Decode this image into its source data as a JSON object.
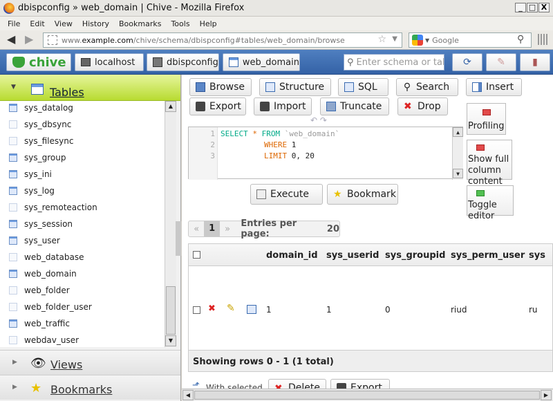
{
  "window": {
    "title": "dbispconfig » web_domain | Chive - Mozilla Firefox",
    "minimize": "_",
    "maximize": "□",
    "close": "X"
  },
  "menu": [
    "File",
    "Edit",
    "View",
    "History",
    "Bookmarks",
    "Tools",
    "Help"
  ],
  "nav": {
    "back": "◀",
    "forward": "▶",
    "url_prefix": "www.",
    "url_host": "example.com",
    "url_path": "/chive/schema/dbispconfig#tables/web_domain/browse",
    "search_placeholder": "Google"
  },
  "header": {
    "logo": "chive",
    "host": "localhost",
    "schema": "dbispconfig",
    "table": "web_domain",
    "schema_search_placeholder": "Enter schema or table"
  },
  "sidebar": {
    "tables_label": "Tables",
    "tables": [
      {
        "name": "sys_datalog",
        "on": true
      },
      {
        "name": "sys_dbsync",
        "on": false
      },
      {
        "name": "sys_filesync",
        "on": false
      },
      {
        "name": "sys_group",
        "on": true
      },
      {
        "name": "sys_ini",
        "on": true
      },
      {
        "name": "sys_log",
        "on": true
      },
      {
        "name": "sys_remoteaction",
        "on": false
      },
      {
        "name": "sys_session",
        "on": true
      },
      {
        "name": "sys_user",
        "on": true
      },
      {
        "name": "web_database",
        "on": false
      },
      {
        "name": "web_domain",
        "on": true
      },
      {
        "name": "web_folder",
        "on": false
      },
      {
        "name": "web_folder_user",
        "on": false
      },
      {
        "name": "web_traffic",
        "on": true
      },
      {
        "name": "webdav_user",
        "on": false
      }
    ],
    "views_label": "Views",
    "bookmarks_label": "Bookmarks"
  },
  "actions": {
    "browse": "Browse",
    "structure": "Structure",
    "sql": "SQL",
    "search": "Search",
    "insert": "Insert",
    "export": "Export",
    "import": "Import",
    "truncate": "Truncate",
    "drop": "Drop"
  },
  "editor": {
    "lines": [
      "1",
      "2",
      "3"
    ],
    "select": "SELECT",
    "star": "*",
    "from": "FROM",
    "table": "`web_domain`",
    "where": "WHERE",
    "where_val": "1",
    "limit": "LIMIT",
    "limit_val": "0, 20"
  },
  "side_options": {
    "profiling": "Profiling",
    "show_full": "Show full column content",
    "toggle": "Toggle editor"
  },
  "buttons": {
    "execute": "Execute",
    "bookmark": "Bookmark"
  },
  "pager": {
    "prev": "«",
    "page": "1",
    "next": "»",
    "entries_label": "Entries per page:",
    "entries": "20"
  },
  "grid": {
    "columns": [
      "domain_id",
      "sys_userid",
      "sys_groupid",
      "sys_perm_user",
      "sys"
    ],
    "row": {
      "domain_id": "1",
      "sys_userid": "1",
      "sys_groupid": "0",
      "sys_perm_user": "riud",
      "next": "ru"
    },
    "footer": "Showing rows 0 - 1 (1 total)"
  },
  "bottom": {
    "with_selected": "With selected",
    "delete": "Delete",
    "export": "Export"
  },
  "colors": {
    "chive_bar": "#3462a6",
    "tables_green": "#b8db31",
    "logo_green": "#3aa33a",
    "drop_red": "#d22"
  }
}
